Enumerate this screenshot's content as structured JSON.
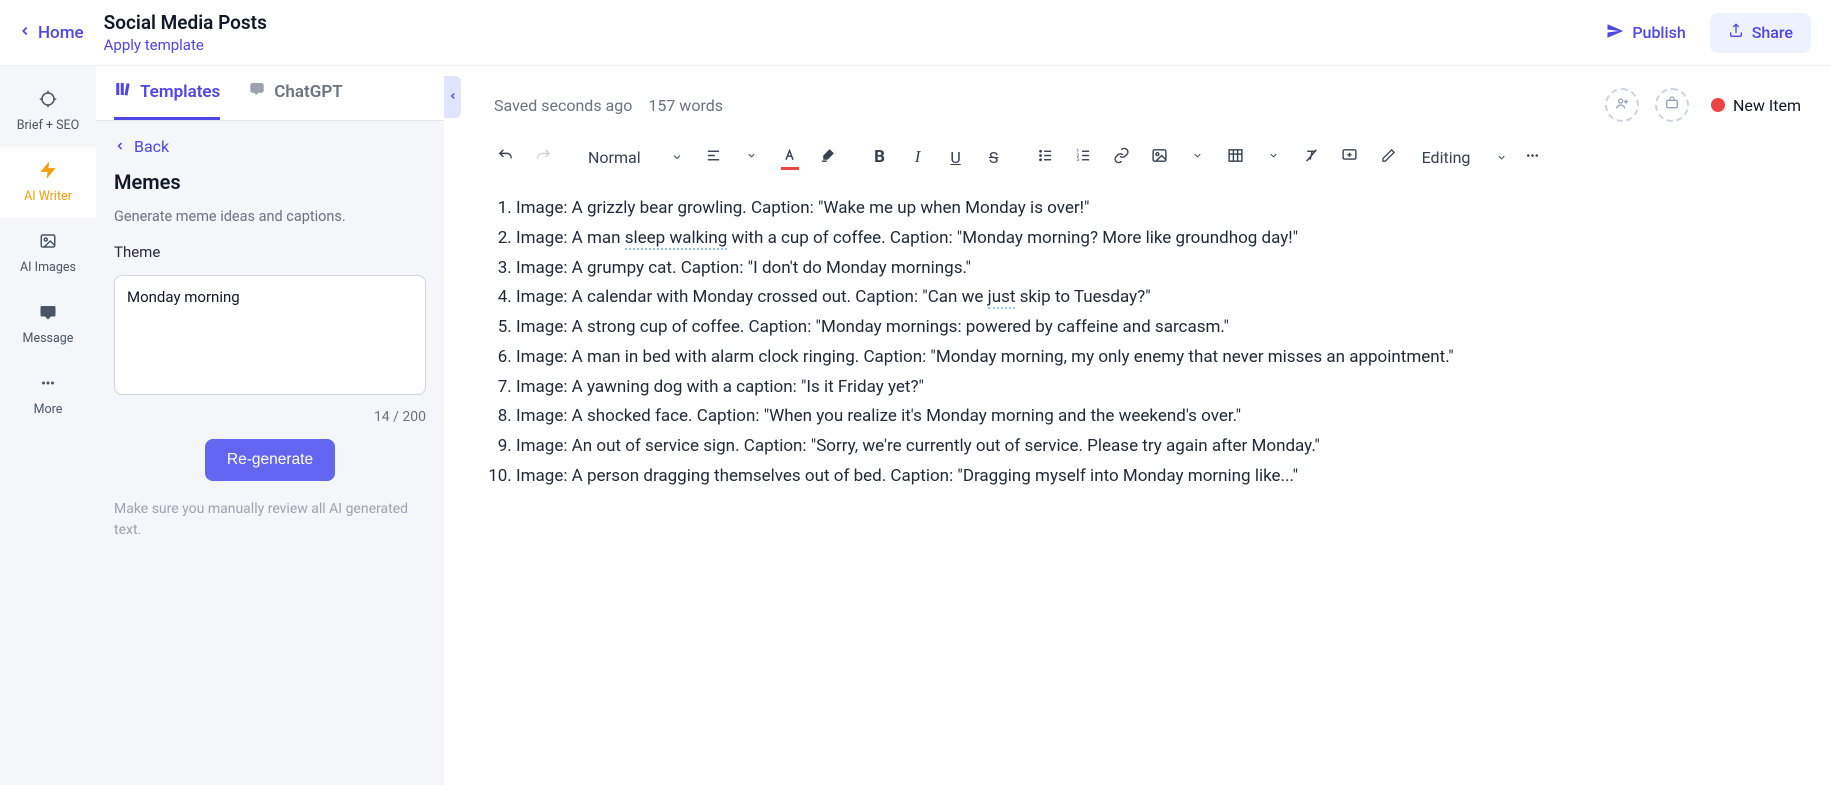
{
  "header": {
    "home_label": "Home",
    "title": "Social Media Posts",
    "apply_template_label": "Apply template",
    "publish_label": "Publish",
    "share_label": "Share"
  },
  "rail": {
    "items": [
      {
        "id": "brief",
        "label": "Brief + SEO"
      },
      {
        "id": "writer",
        "label": "AI Writer"
      },
      {
        "id": "images",
        "label": "AI Images"
      },
      {
        "id": "message",
        "label": "Message"
      },
      {
        "id": "more",
        "label": "More"
      }
    ],
    "active": "writer"
  },
  "panel": {
    "tabs": {
      "templates": "Templates",
      "chatgpt": "ChatGPT"
    },
    "active_tab": "templates",
    "back_label": "Back",
    "section_title": "Memes",
    "section_desc": "Generate meme ideas and captions.",
    "theme_label": "Theme",
    "theme_value": "Monday morning",
    "char_count": "14 / 200",
    "regenerate_label": "Re-generate",
    "review_note": "Make sure you manually review all AI generated text."
  },
  "editor": {
    "saved_text": "Saved seconds ago",
    "word_count": "157 words",
    "status_label": "New Item",
    "format_label": "Normal",
    "mode_label": "Editing"
  },
  "content": {
    "items": [
      "Image: A grizzly bear growling. Caption: \"Wake me up when Monday is over!\"",
      "Image: A man sleep walking with a cup of coffee. Caption: \"Monday morning? More like groundhog day!\"",
      "Image: A grumpy cat. Caption: \"I don't do Monday mornings.\"",
      "Image: A calendar with Monday crossed out. Caption: \"Can we just skip to Tuesday?\"",
      "Image: A strong cup of coffee. Caption: \"Monday mornings: powered by caffeine and sarcasm.\"",
      "Image: A man in bed with alarm clock ringing. Caption: \"Monday morning, my only enemy that never misses an appointment.\"",
      "Image: A yawning dog with a caption: \"Is it Friday yet?\"",
      "Image: A shocked face. Caption: \"When you realize it's Monday morning and the weekend's over.\"",
      "Image: An out of service sign. Caption: \"Sorry, we're currently out of service. Please try again after Monday.\"",
      "Image: A person dragging themselves out of bed. Caption: \"Dragging myself into Monday morning like...\""
    ]
  }
}
